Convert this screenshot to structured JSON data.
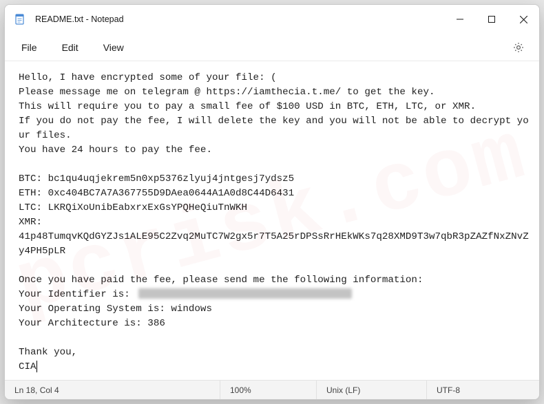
{
  "window": {
    "title": "README.txt - Notepad"
  },
  "menu": {
    "file": "File",
    "edit": "Edit",
    "view": "View"
  },
  "body": {
    "l1": "Hello, I have encrypted some of your file: (",
    "l2": "Please message me on telegram @ https://iamthecia.t.me/ to get the key.",
    "l3": "This will require you to pay a small fee of $100 USD in BTC, ETH, LTC, or XMR.",
    "l4": "If you do not pay the fee, I will delete the key and you will not be able to decrypt your files.",
    "l5": "You have 24 hours to pay the fee.",
    "blank1": "",
    "btc": "BTC: bc1qu4uqjekrem5n0xp5376zlyuj4jntgesj7ydsz5",
    "eth": "ETH: 0xc404BC7A7A367755D9DAea0644A1A0d8C44D6431",
    "ltc": "LTC: LKRQiXoUnibEabxrxExGsYPQHeQiuTnWKH",
    "xmr_label": "XMR:",
    "xmr_addr": "41p48TumqvKQdGYZJs1ALE95C2Zvq2MuTC7W2gx5r7T5A25rDPSsRrHEkWKs7q28XMD9T3w7qbR3pZAZfNxZNvZy4PH5pLR",
    "blank2": "",
    "paid": "Once you have paid the fee, please send me the following information:",
    "id_label": "Your Identifier is: ",
    "os": "Your Operating System is: windows",
    "arch": "Your Architecture is: 386",
    "blank3": "",
    "thanks": "Thank you,",
    "sig": "CIA"
  },
  "status": {
    "pos": "Ln 18, Col 4",
    "zoom": "100%",
    "eol": "Unix (LF)",
    "enc": "UTF-8"
  }
}
